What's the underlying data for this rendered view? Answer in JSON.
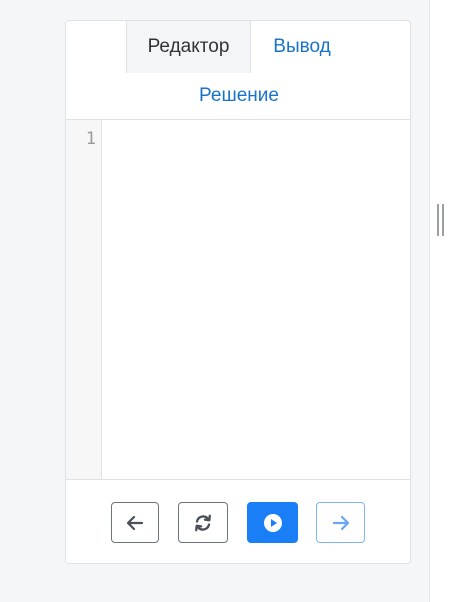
{
  "tabs": {
    "editor_label": "Редактор",
    "output_label": "Вывод"
  },
  "solution_link": "Решение",
  "editor": {
    "line_numbers": [
      "1"
    ],
    "code": ""
  },
  "toolbar": {
    "icons": [
      "arrow-left-icon",
      "refresh-icon",
      "play-icon",
      "arrow-right-icon"
    ]
  },
  "colors": {
    "accent": "#1a7ff7",
    "link": "#1a73c8",
    "outline": "#6c757d",
    "disabled_outline": "#7fb4f5"
  }
}
